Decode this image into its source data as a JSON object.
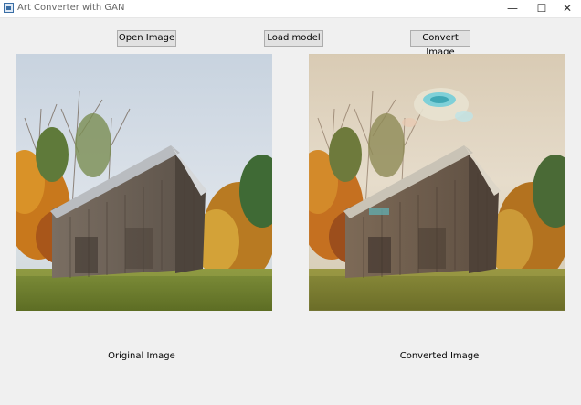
{
  "window": {
    "title": "Art Converter with GAN",
    "controls": [
      "minimize-icon",
      "maximize-icon",
      "close-icon"
    ]
  },
  "toolbar": {
    "open_label": "Open Image",
    "load_label": "Load model",
    "convert_label": "Convert Image"
  },
  "captions": {
    "original": "Original Image",
    "converted": "Converted Image"
  },
  "images": {
    "original": "photo of a weathered wooden barn with a metal roof among autumn trees, grassy field in front",
    "converted": "GAN-stylized version of the same barn photo with painterly color artifacts in the sky"
  }
}
